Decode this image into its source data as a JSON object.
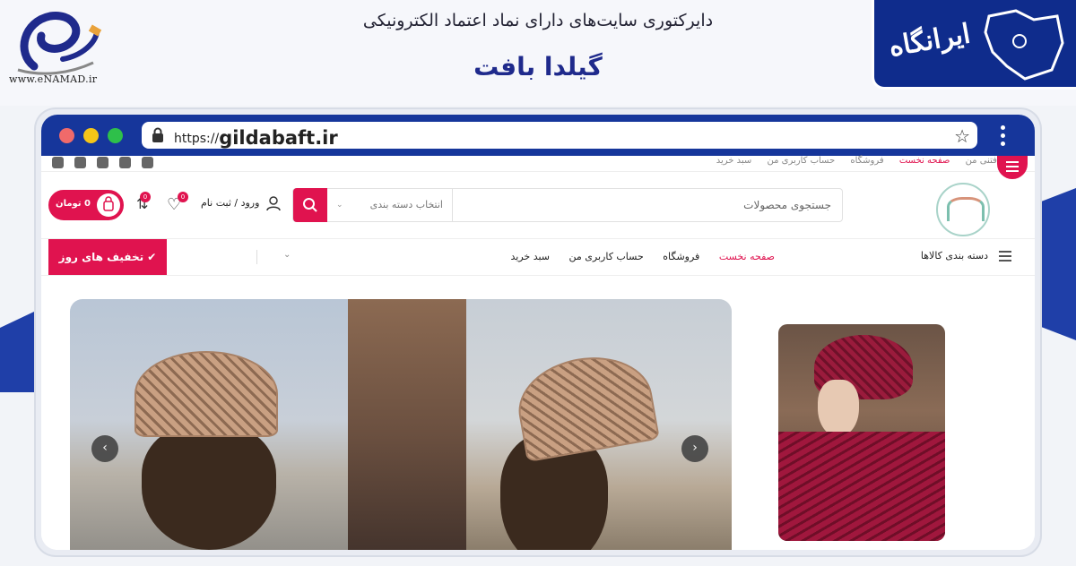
{
  "banner": {
    "enamad_text": "www.eNAMAD.ir",
    "directory_title": "دایرکتوری سایت‌های دارای نماد اعتماد الکترونیکی",
    "site_title": "گیلدا بافت",
    "iran_logo_text": "ایرانگاه"
  },
  "browser": {
    "url_prefix": "https://",
    "url_domain": "gildabaft.ir"
  },
  "topbar": {
    "links": [
      "دنیای بافتنی من",
      "صفحه نخست",
      "فروشگاه",
      "حساب کاربری من",
      "سبد خرید"
    ]
  },
  "header": {
    "search_placeholder": "جستجوی محصولات",
    "category_select": "انتخاب دسته بندی",
    "login_label": "ورود / ثبت نام",
    "wishlist_count": "0",
    "compare_count": "0",
    "cart_label": "0 تومان"
  },
  "nav": {
    "categories_label": "دسته بندی کالاها",
    "links": [
      "صفحه نخست",
      "فروشگاه",
      "حساب کاربری من",
      "سبد خرید"
    ],
    "deals_label": "✔ تخفیف های روز"
  },
  "colors": {
    "accent": "#e0134f",
    "chrome_blue": "#16369b",
    "title_blue": "#1f2a8c"
  }
}
